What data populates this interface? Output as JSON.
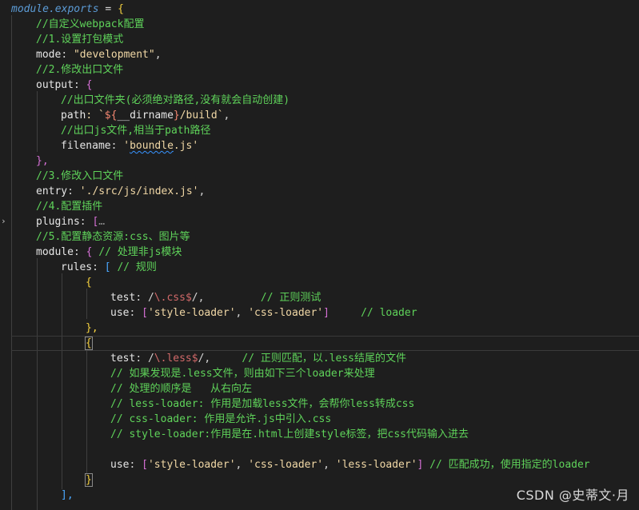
{
  "editor": {
    "fold_icon": "chevron-right-icon",
    "lines": [
      {
        "t1": "module.exports",
        "t2": " = ",
        "t3": "{"
      },
      {
        "t1": "//自定义webpack配置"
      },
      {
        "t1": "//1.设置打包模式"
      },
      {
        "t1": "mode",
        "t2": ": ",
        "t3": "\"development\"",
        "t4": ","
      },
      {
        "t1": "//2.修改出口文件"
      },
      {
        "t1": "output",
        "t2": ": ",
        "t3": "{"
      },
      {
        "t1": "//出口文件夹(必须绝对路径,没有就会自动创建)"
      },
      {
        "t1": "path",
        "t2": ": `",
        "t3": "${",
        "t4": "__dirname",
        "t5": "}",
        "t6": "/build`",
        "t7": ","
      },
      {
        "t1": "//出口js文件,相当于path路径"
      },
      {
        "t1": "filename",
        "t2": ": ",
        "t3": "'",
        "t4": "boundle",
        "t5": ".js'"
      },
      {
        "t1": "},"
      },
      {
        "t1": "//3.修改入口文件"
      },
      {
        "t1": "entry",
        "t2": ": ",
        "t3": "'./src/js/index.js'",
        "t4": ","
      },
      {
        "t1": "//4.配置插件"
      },
      {
        "t1": "plugins",
        "t2": ": ",
        "t3": "[",
        "t4": "…"
      },
      {
        "t1": "//5.配置静态资源:css、图片等"
      },
      {
        "t1": "module",
        "t2": ": ",
        "t3": "{",
        "t4": " // 处理非js模块"
      },
      {
        "t1": "rules",
        "t2": ": ",
        "t3": "[",
        "t4": " // 规则"
      },
      {
        "t1": "{"
      },
      {
        "t1": "test",
        "t2": ": /",
        "t3": "\\.css",
        "t4": "$",
        "t5": "/,",
        "t6": "         // 正则测试"
      },
      {
        "t1": "use",
        "t2": ": ",
        "t3": "[",
        "t4": "'style-loader'",
        "t5": ", ",
        "t6": "'css-loader'",
        "t7": "]",
        "t8": "     // loader"
      },
      {
        "t1": "},"
      },
      {
        "t1": "{"
      },
      {
        "t1": "test",
        "t2": ": /",
        "t3": "\\.less",
        "t4": "$",
        "t5": "/,",
        "t6": "     // 正则匹配，以.less结尾的文件"
      },
      {
        "t1": "// 如果发现是.less文件，则由如下三个loader来处理"
      },
      {
        "t1": "// 处理的顺序是   从右向左"
      },
      {
        "t1": "// less-loader: 作用是加载less文件，会帮你less转成css"
      },
      {
        "t1": "// css-loader: 作用是允许.js中引入.css"
      },
      {
        "t1": "// style-loader:作用是在.html上创建style标签，把css代码输入进去"
      },
      {
        "t1": ""
      },
      {
        "t1": "use",
        "t2": ": ",
        "t3": "[",
        "t4": "'style-loader'",
        "t5": ", ",
        "t6": "'css-loader'",
        "t7": ", ",
        "t8": "'less-loader'",
        "t9": "]",
        "t10": " // 匹配成功，使用指定的loader"
      },
      {
        "t1": "}"
      },
      {
        "t1": "],"
      }
    ]
  },
  "watermark": "CSDN @史蒂文·月",
  "colors": {
    "background": "#1e1e1e",
    "comment": "#5fd35a",
    "string": "#f1d8a6",
    "regex": "#d16969",
    "brace_yellow": "#f4d03f",
    "brace_purple": "#d670d6",
    "brace_blue": "#4aa8ff"
  }
}
